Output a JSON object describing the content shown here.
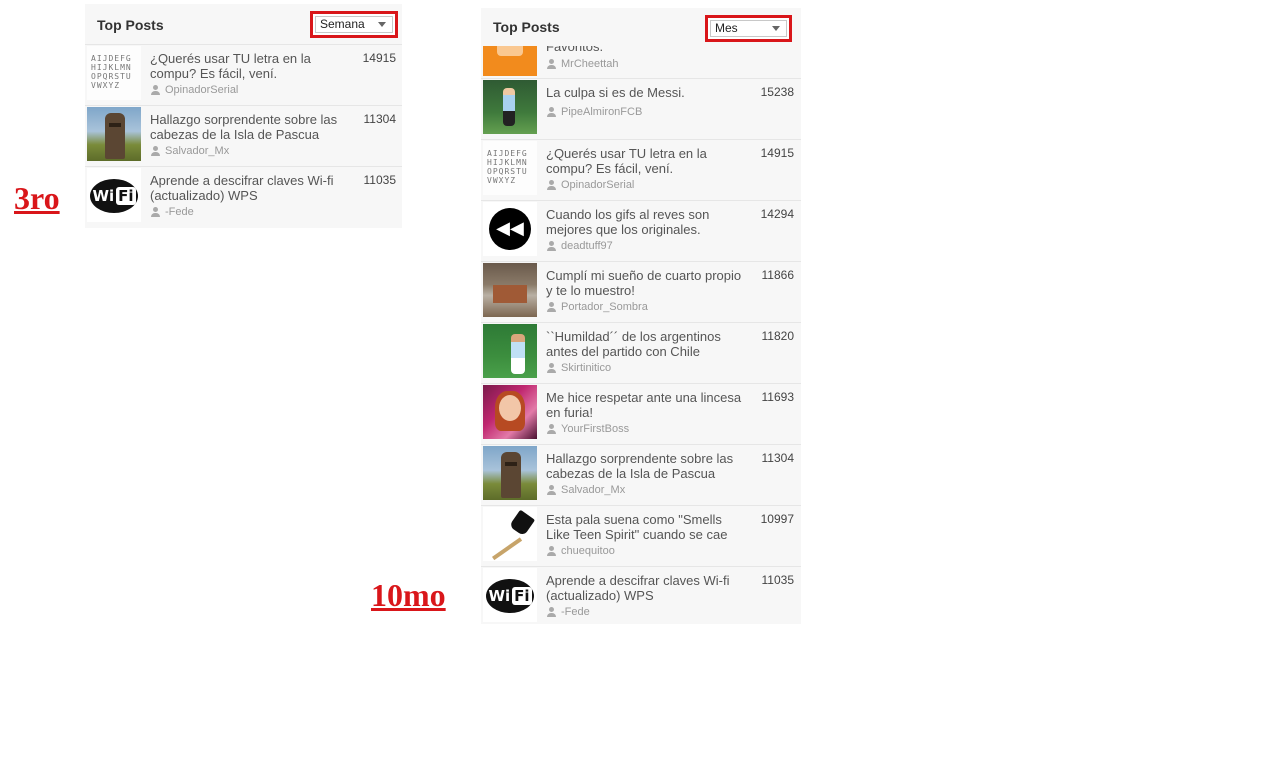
{
  "left_panel": {
    "title": "Top Posts",
    "select_value": "Semana",
    "rank_label": "3ro",
    "posts": [
      {
        "title": "¿Querés usar TU letra en la compu? Es fácil, vení.",
        "author": "OpinadorSerial",
        "score": "14915",
        "thumb": "font-sample"
      },
      {
        "title": "Hallazgo sorprendente sobre las cabezas de la Isla de Pascua",
        "author": "Salvador_Mx",
        "score": "11304",
        "thumb": "moai"
      },
      {
        "title": "Aprende a descifrar claves Wi-fi (actualizado) WPS",
        "author": "-Fede",
        "score": "11035",
        "thumb": "wifi-logo"
      }
    ]
  },
  "right_panel": {
    "title": "Top Posts",
    "select_value": "Mes",
    "rank_label": "10mo",
    "partial_post": {
      "title_fragment": "Favoritos.",
      "author": "MrCheettah",
      "thumb": "orange"
    },
    "posts": [
      {
        "title": "La culpa si es de Messi.",
        "author": "PipeAlmironFCB",
        "score": "15238",
        "thumb": "soccer-player"
      },
      {
        "title": "¿Querés usar TU letra en la compu? Es fácil, vení.",
        "author": "OpinadorSerial",
        "score": "14915",
        "thumb": "font-sample"
      },
      {
        "title": "Cuando los gifs al reves son mejores que los originales.",
        "author": "deadtuff97",
        "score": "14294",
        "thumb": "rewind"
      },
      {
        "title": "Cumplí mi sueño de cuarto propio y te lo muestro!",
        "author": "Portador_Sombra",
        "score": "11866",
        "thumb": "room"
      },
      {
        "title": "``Humildad´´ de los argentinos antes del partido con Chile",
        "author": "Skirtinitico",
        "score": "11820",
        "thumb": "soccer-player-2"
      },
      {
        "title": "Me hice respetar ante una lincesa en furia!",
        "author": "YourFirstBoss",
        "score": "11693",
        "thumb": "lady"
      },
      {
        "title": "Hallazgo sorprendente sobre las cabezas de la Isla de Pascua",
        "author": "Salvador_Mx",
        "score": "11304",
        "thumb": "moai"
      },
      {
        "title": "Esta pala suena como \"Smells Like Teen Spirit\" cuando se cae",
        "author": "chuequitoo",
        "score": "10997",
        "thumb": "shovel"
      },
      {
        "title": "Aprende a descifrar claves Wi-fi (actualizado) WPS",
        "author": "-Fede",
        "score": "11035",
        "thumb": "wifi-logo"
      }
    ]
  },
  "glyph_sample": "AIJDEFG HIJKLMN OPQRSTU VWXYZ",
  "wifi_text": {
    "wi": "Wi",
    "fi": "Fi"
  },
  "rewind_glyph": "◀◀",
  "accent_color": "#d9161a"
}
